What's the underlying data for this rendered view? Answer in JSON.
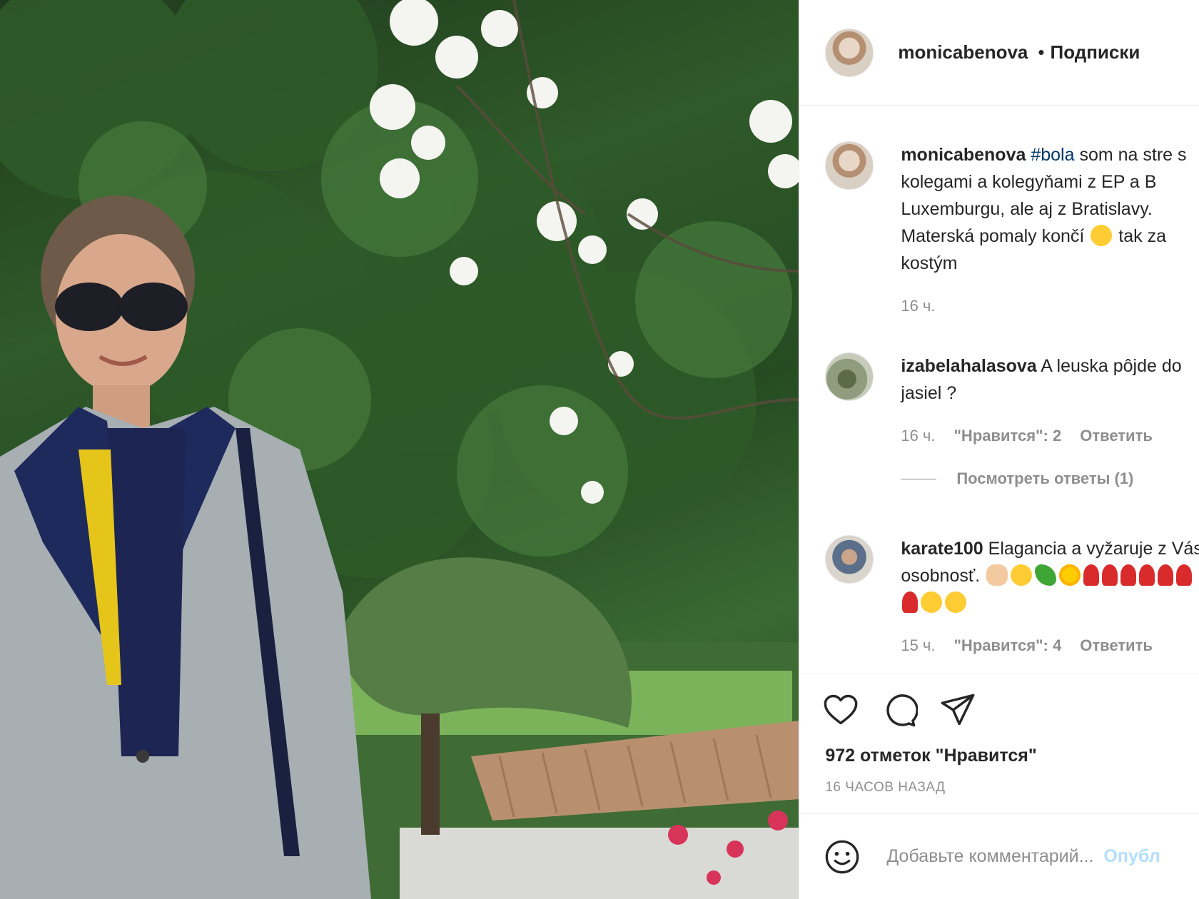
{
  "header": {
    "username": "monicabenova",
    "separator": "•",
    "follow_label": "Подписки"
  },
  "caption": {
    "username": "monicabenova",
    "hashtag": "#bola",
    "text": " som na stre s kolegami a kolegyňami z EP a B Luxemburgu, ale aj z Bratislavy. Materská pomaly končí",
    "text_after_emoji": " tak za kostým",
    "time": "16 ч."
  },
  "comments": [
    {
      "username": "izabelahalasova",
      "text": " A leuska pôjde do jasiel ?",
      "time": "16 ч.",
      "likes": "\"Нравится\": 2",
      "reply_label": "Ответить",
      "view_replies": "Посмотреть ответы (1)"
    },
    {
      "username": "karate100",
      "text": " Elagancia a vyžaruje z Vás osobnosť.",
      "time": "15 ч.",
      "likes": "\"Нравится\": 4",
      "reply_label": "Ответить"
    }
  ],
  "actions": {
    "icons": [
      "heart-icon",
      "comment-icon",
      "share-icon"
    ],
    "likes_count": "972 отметок \"Нравится\"",
    "posted_ago": "16 ЧАСОВ НАЗАД"
  },
  "add_comment": {
    "icon": "emoji-icon",
    "placeholder": "Добавьте комментарий...",
    "post_label": "Опубл"
  }
}
